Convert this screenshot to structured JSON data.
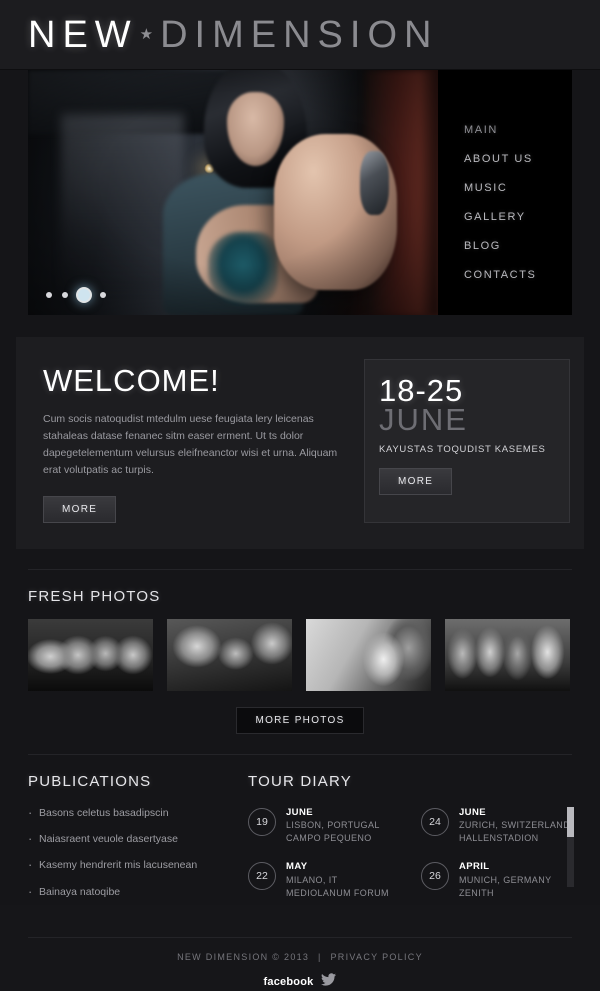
{
  "site": {
    "logo_primary": "NEW",
    "logo_star": "★",
    "logo_secondary": "DIMENSION"
  },
  "nav": {
    "items": [
      {
        "label": "MAIN"
      },
      {
        "label": "ABOUT US"
      },
      {
        "label": "MUSIC"
      },
      {
        "label": "GALLERY"
      },
      {
        "label": "BLOG"
      },
      {
        "label": "CONTACTS"
      }
    ]
  },
  "hero": {
    "image_alt": "band-member-fist-portrait",
    "slider": {
      "total_dots": 4,
      "active_index": 2
    }
  },
  "welcome": {
    "title": "WELCOME!",
    "body": "Cum socis natoqudist mtedulm uese feugiata lery leicenas stahaleas datase fenanec sitm easer erment. Ut ts dolor dapegetelementum velursus eleifneanctor wisi et urna. Aliquam erat volutpatis ac turpis.",
    "more_label": "MORE"
  },
  "event": {
    "dates": "18-25",
    "month": "JUNE",
    "place": "KAYUSTAS TOQUDIST KASEMES",
    "more_label": "MORE"
  },
  "photos": {
    "title": "FRESH PHOTOS",
    "items": [
      {
        "alt": "band-performing-live"
      },
      {
        "alt": "acoustic-guitar-session"
      },
      {
        "alt": "singer-with-microphone"
      },
      {
        "alt": "band-group-portrait"
      }
    ],
    "more_label": "MORE PHOTOS"
  },
  "publications": {
    "title": "PUBLICATIONS",
    "items": [
      {
        "label": "Basons celetus basadipscin"
      },
      {
        "label": "Naiasraent veuole dasertyase"
      },
      {
        "label": "Kasemy hendrerit mis lacusenean"
      },
      {
        "label": "Bainaya natoqibe"
      }
    ]
  },
  "tour": {
    "title": "TOUR DIARY",
    "left_column": [
      {
        "day": "19",
        "month": "JUNE",
        "city": "LISBON, PORTUGAL",
        "venue": "CAMPO PEQUENO"
      },
      {
        "day": "22",
        "month": "MAY",
        "city": "MILANO, IT",
        "venue": "MEDIOLANUM FORUM"
      }
    ],
    "right_column": [
      {
        "day": "24",
        "month": "JUNE",
        "city": "ZURICH, SWITZERLAND",
        "venue": "HALLENSTADION"
      },
      {
        "day": "26",
        "month": "APRIL",
        "city": "MUNICH, GERMANY",
        "venue": "ZENITH"
      }
    ]
  },
  "footer": {
    "copyright": "NEW DIMENSION © 2013",
    "separator": "|",
    "privacy_label": "PRIVACY POLICY",
    "facebook_label": "facebook",
    "twitter_icon": "twitter-bird-icon"
  },
  "colors": {
    "page_background": "#161619",
    "panel_background": "#1d1d20",
    "event_panel": "#252528",
    "nav_panel": "#000000",
    "text_primary": "#ffffff",
    "text_muted": "#9a9aa0",
    "rule": "#242428"
  }
}
